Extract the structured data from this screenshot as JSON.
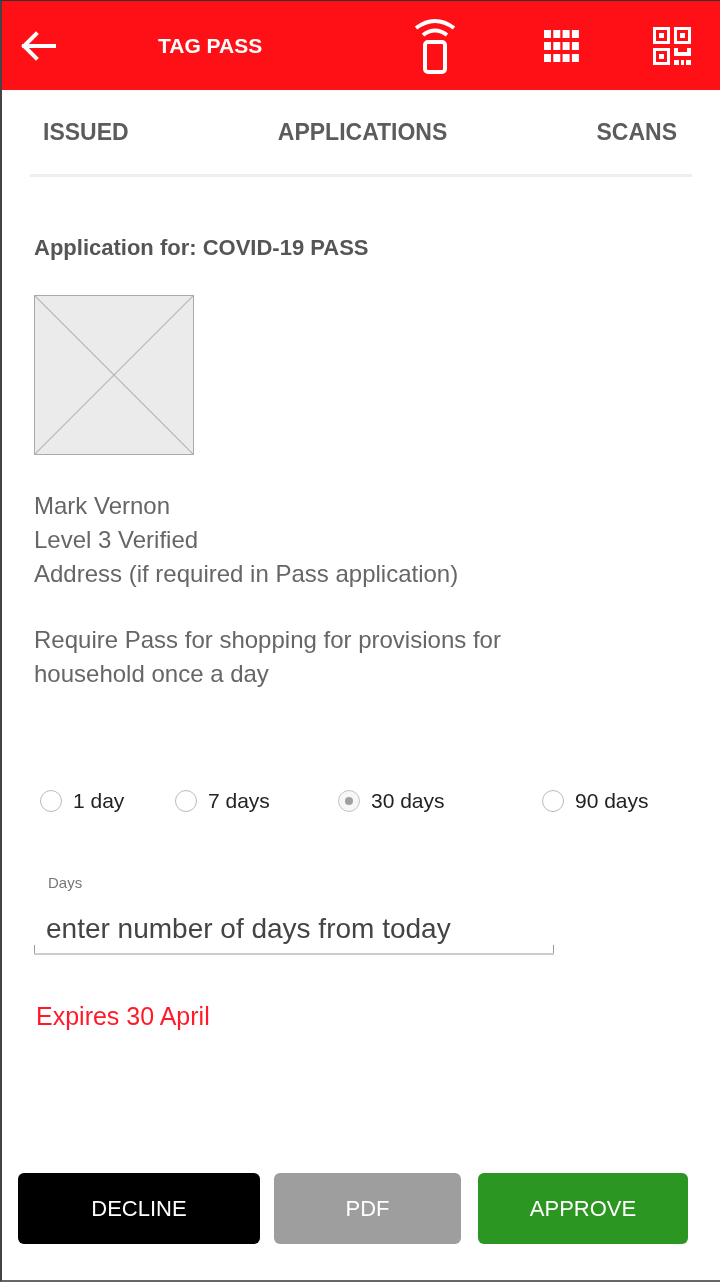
{
  "header": {
    "title": "TAG PASS"
  },
  "tabs": [
    {
      "label": "ISSUED"
    },
    {
      "label": "APPLICATIONS"
    },
    {
      "label": "SCANS"
    }
  ],
  "application": {
    "heading": "Application for: COVID-19 PASS",
    "name": "Mark Vernon",
    "verification": "Level 3 Verified",
    "address": "Address (if required in Pass application)",
    "reason": "Require Pass for shopping for provisions for household once a day"
  },
  "duration_options": [
    {
      "label": "1 day",
      "selected": false
    },
    {
      "label": "7 days",
      "selected": false
    },
    {
      "label": "30 days",
      "selected": true
    },
    {
      "label": "90 days",
      "selected": false
    }
  ],
  "days_field": {
    "label": "Days",
    "placeholder": "enter number of days from today"
  },
  "expiry": "Expires 30 April",
  "buttons": [
    {
      "label": "DECLINE",
      "kind": "dark"
    },
    {
      "label": "PDF",
      "kind": "muted"
    },
    {
      "label": "APPROVE",
      "kind": "success"
    }
  ]
}
